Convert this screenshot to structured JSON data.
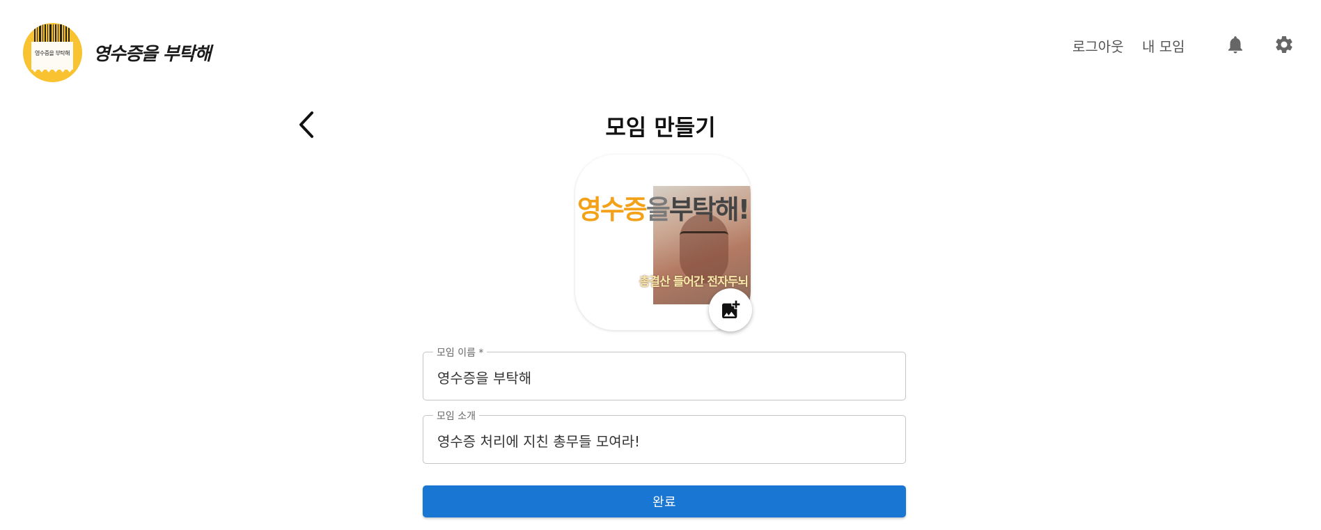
{
  "brand": {
    "logo_receipt_text": "영수증을 부탁해",
    "wordmark": "영수증을 부탁해"
  },
  "nav": {
    "logout": "로그아웃",
    "my_group": "내 모임",
    "icons": [
      "bell-icon",
      "gear-icon"
    ]
  },
  "page": {
    "title": "모임 만들기"
  },
  "group_image": {
    "text_part1": "영수증",
    "text_part2": "을",
    "text_part3": "부탁해!",
    "caption": "총결산 들어간 전자두뇌"
  },
  "form": {
    "name_label": "모임 이름 *",
    "name_value": "영수증을 부탁해",
    "desc_label": "모임 소개",
    "desc_value": "영수증 처리에 지친 총무들 모여라!",
    "submit_label": "완료"
  },
  "colors": {
    "primary": "#1976d2",
    "logo_yellow": "#f8c231",
    "image_orange": "#f4a11a"
  }
}
